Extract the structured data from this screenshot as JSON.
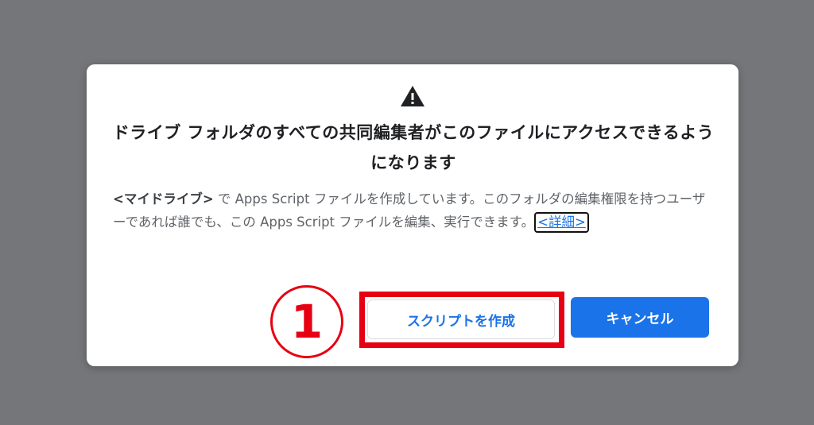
{
  "dialog": {
    "title": "ドライブ フォルダのすべての共同編集者がこのファイルにアクセスできるようになります",
    "body_bold": "<マイドライブ>",
    "body_text": " で Apps Script ファイルを作成しています。このフォルダの編集権限を持つユーザーであれば誰でも、この Apps Script ファイルを編集、実行できます。",
    "details_link": "<詳細>",
    "create_button": "スクリプトを作成",
    "cancel_button": "キャンセル"
  },
  "annotation": {
    "step_number": "1"
  },
  "colors": {
    "backdrop": "#75767a",
    "primary": "#1a73e8",
    "annotation": "#e60012"
  },
  "icons": {
    "warning": "warning-triangle-icon"
  }
}
